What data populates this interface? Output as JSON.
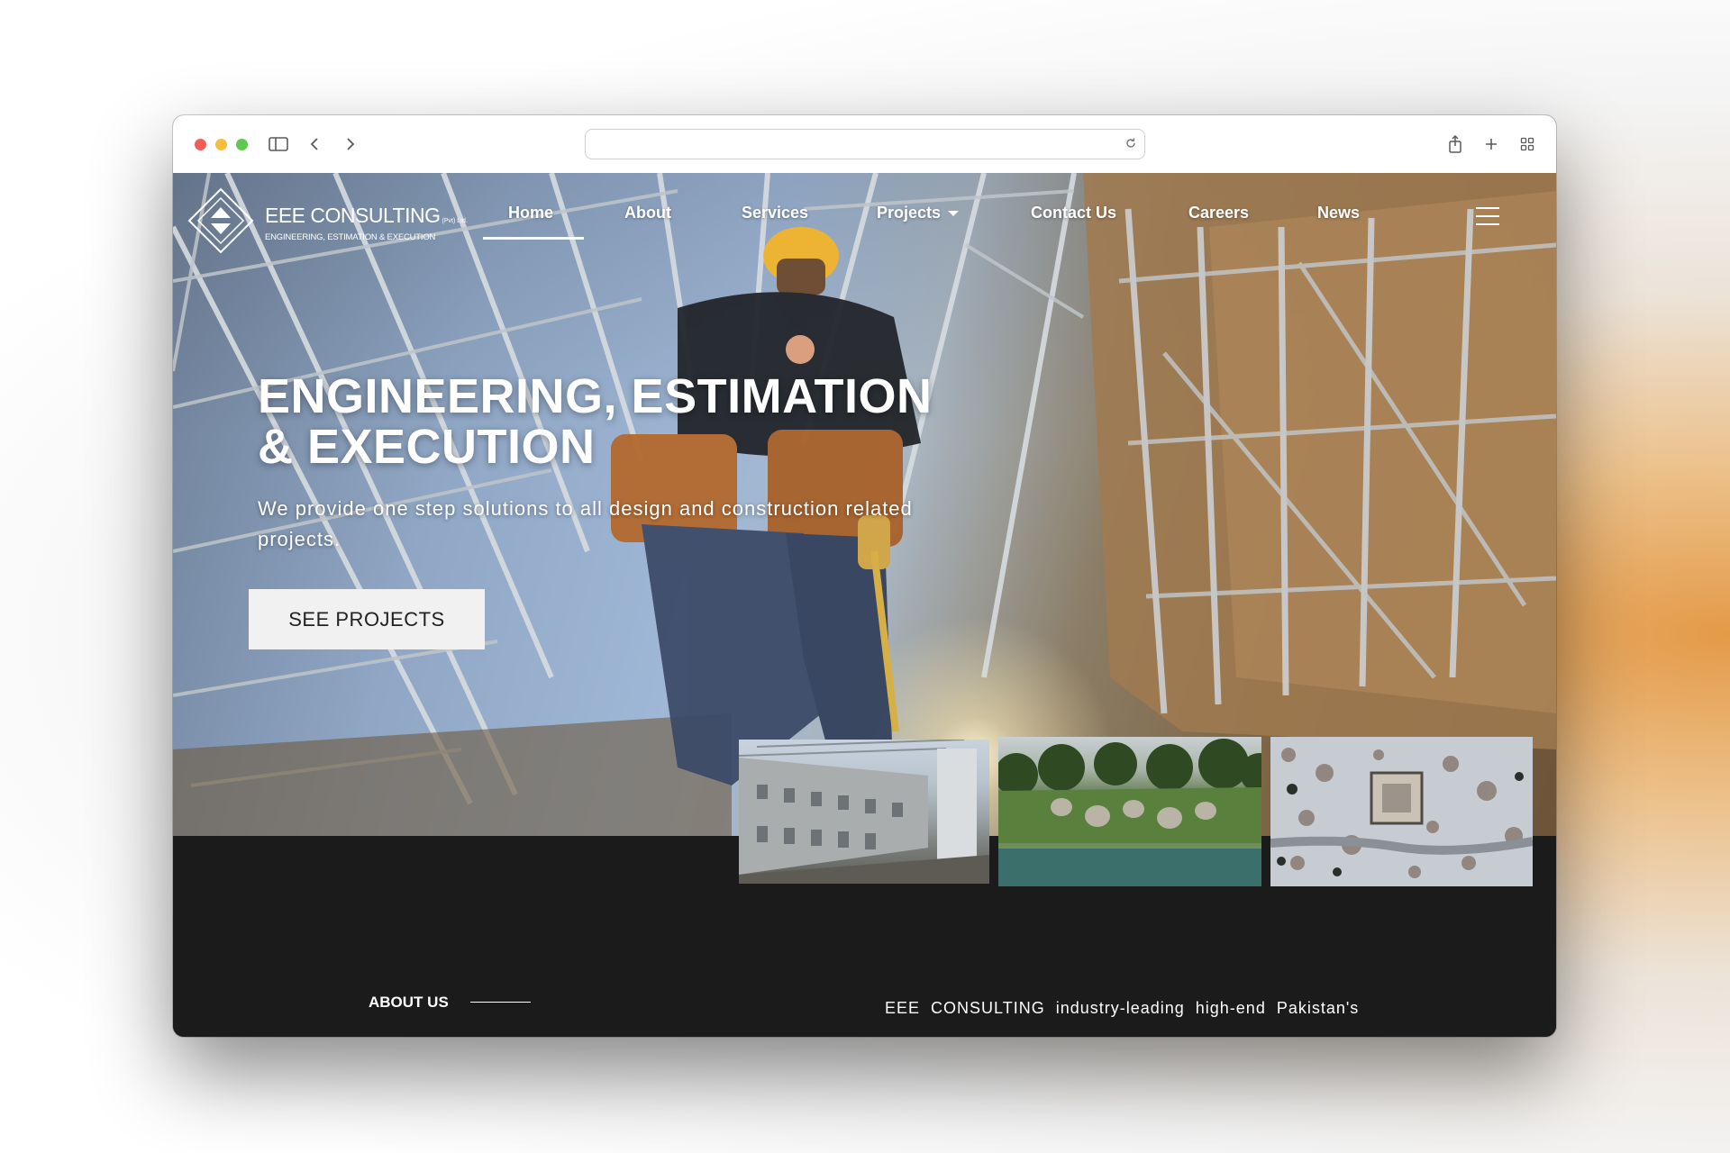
{
  "browser": {
    "url": ""
  },
  "brand": {
    "name": "EEE CONSULTING",
    "suffix": "(Pvt) Ltd.",
    "tagline": "ENGINEERING, ESTIMATION & EXECUTION"
  },
  "nav": {
    "items": [
      {
        "label": "Home",
        "active": true
      },
      {
        "label": "About"
      },
      {
        "label": "Services"
      },
      {
        "label": "Projects",
        "has_dropdown": true
      },
      {
        "label": "Contact Us"
      },
      {
        "label": "Careers"
      },
      {
        "label": "News"
      }
    ]
  },
  "hero": {
    "headline_line1": "ENGINEERING, ESTIMATION",
    "headline_line2": "& EXECUTION",
    "subtext": "We provide one step solutions to all design and construction related projects.",
    "cta_label": "SEE PROJECTS"
  },
  "about": {
    "label": "ABOUT US",
    "intro": "EEE CONSULTING industry-leading high-end Pakistan's"
  },
  "colors": {
    "page_dark": "#1b1b1b",
    "text_light": "#ffffff",
    "button_bg": "#f1f1f1"
  }
}
